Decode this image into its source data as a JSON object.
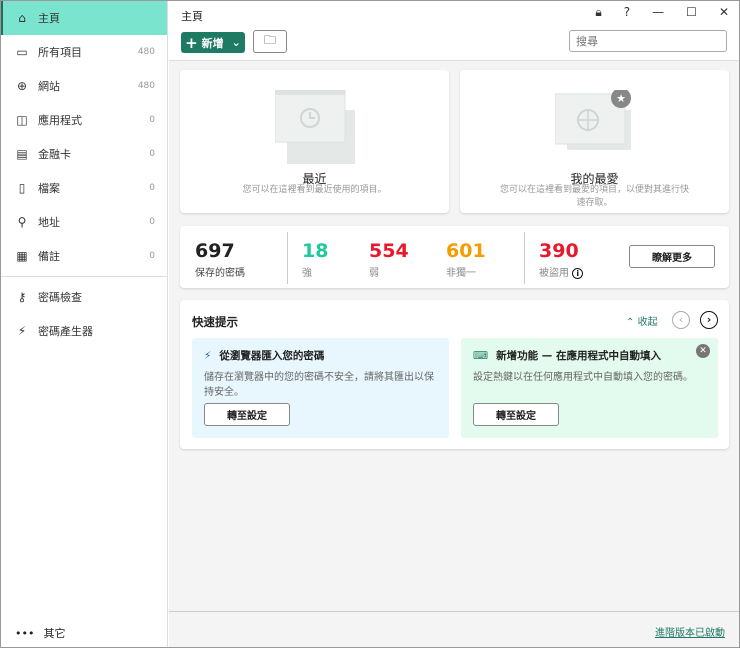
{
  "sidebar": {
    "items": [
      {
        "label": "主頁",
        "icon": "home-icon",
        "glyph": "⌂",
        "count": ""
      },
      {
        "label": "所有項目",
        "icon": "folder-icon",
        "glyph": "▭",
        "count": "480"
      },
      {
        "label": "網站",
        "icon": "globe-icon",
        "glyph": "⊕",
        "count": "480"
      },
      {
        "label": "應用程式",
        "icon": "app-icon",
        "glyph": "◫",
        "count": "0"
      },
      {
        "label": "金融卡",
        "icon": "card-icon",
        "glyph": "▤",
        "count": "0"
      },
      {
        "label": "檔案",
        "icon": "document-icon",
        "glyph": "▯",
        "count": "0"
      },
      {
        "label": "地址",
        "icon": "location-pin-icon",
        "glyph": "⚲",
        "count": "0"
      },
      {
        "label": "備註",
        "icon": "notes-icon",
        "glyph": "▦",
        "count": "0"
      }
    ],
    "tools": [
      {
        "label": "密碼檢查",
        "icon": "key-icon",
        "glyph": "⚷"
      },
      {
        "label": "密碼產生器",
        "icon": "magic-wand-icon",
        "glyph": "⚡"
      }
    ],
    "other": "其它"
  },
  "header": {
    "title": "主頁",
    "add_label": "新增",
    "search_placeholder": "搜尋"
  },
  "recent": {
    "title": "最近",
    "subtitle": "您可以在這裡看到最近使用的項目。"
  },
  "favorites": {
    "title": "我的最愛",
    "subtitle": "您可以在這裡看到最愛的項目，以便對其進行快速存取。"
  },
  "stats": {
    "saved": {
      "value": "697",
      "label": "保存的密碼"
    },
    "strong": {
      "value": "18",
      "label": "強",
      "color": "#1ec99a"
    },
    "weak": {
      "value": "554",
      "label": "弱",
      "color": "#e8192c"
    },
    "duplicate": {
      "value": "601",
      "label": "非獨一",
      "color": "#f59c00"
    },
    "breached": {
      "value": "390",
      "label": "被盜用",
      "color": "#e8192c"
    },
    "learn_more": "瞭解更多"
  },
  "tips": {
    "title": "快速提示",
    "collapse": "收起",
    "items": [
      {
        "title": "從瀏覽器匯入您的密碼",
        "desc": "儲存在瀏覽器中的您的密碼不安全，請將其匯出以保持安全。",
        "button": "轉至設定",
        "color": "#e8f6fd"
      },
      {
        "title": "新增功能 — 在應用程式中自動填入",
        "desc": "設定熱鍵以在任何應用程式中自動填入您的密碼。",
        "button": "轉至設定",
        "color": "#e3fbee"
      }
    ]
  },
  "footer": {
    "link": "進階版本已啟動"
  }
}
